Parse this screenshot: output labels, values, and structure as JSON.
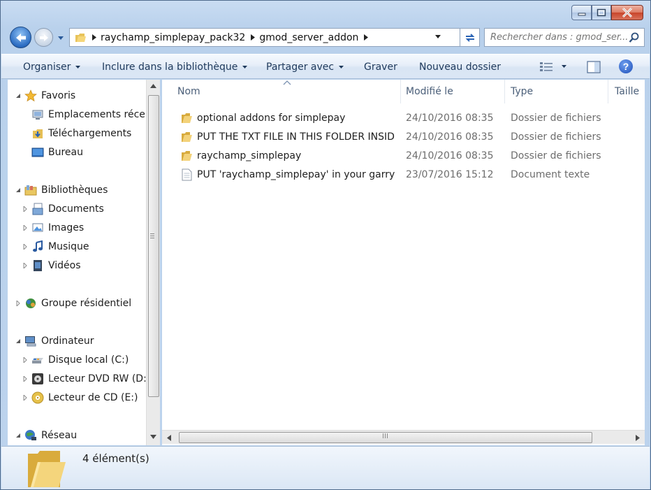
{
  "window": {
    "caption_buttons": {
      "minimize": "minimize",
      "maximize": "maximize",
      "close": "close"
    }
  },
  "navbar": {
    "breadcrumb": [
      "raychamp_simplepay_pack32",
      "gmod_server_addon"
    ],
    "search_placeholder": "Rechercher dans : gmod_ser..."
  },
  "toolbar": {
    "organize": "Organiser",
    "include_library": "Inclure dans la bibliothèque",
    "share_with": "Partager avec",
    "burn": "Graver",
    "new_folder": "Nouveau dossier"
  },
  "sidebar": {
    "favorites": {
      "label": "Favoris",
      "items": [
        {
          "label": "Emplacements récents",
          "icon": "recent-places-icon"
        },
        {
          "label": "Téléchargements",
          "icon": "downloads-icon"
        },
        {
          "label": "Bureau",
          "icon": "desktop-icon"
        }
      ]
    },
    "libraries": {
      "label": "Bibliothèques",
      "items": [
        {
          "label": "Documents",
          "icon": "documents-icon"
        },
        {
          "label": "Images",
          "icon": "pictures-icon"
        },
        {
          "label": "Musique",
          "icon": "music-icon"
        },
        {
          "label": "Vidéos",
          "icon": "videos-icon"
        }
      ]
    },
    "homegroup": {
      "label": "Groupe résidentiel"
    },
    "computer": {
      "label": "Ordinateur",
      "items": [
        {
          "label": "Disque local (C:)",
          "icon": "hard-drive-icon"
        },
        {
          "label": "Lecteur DVD RW (D:)",
          "icon": "dvd-drive-icon"
        },
        {
          "label": "Lecteur de CD (E:)",
          "icon": "cd-drive-icon"
        }
      ]
    },
    "network": {
      "label": "Réseau"
    }
  },
  "file_list": {
    "columns": [
      "Nom",
      "Modifié le",
      "Type",
      "Taille"
    ],
    "rows": [
      {
        "name": "optional addons for simplepay",
        "modified": "24/10/2016 08:35",
        "type": "Dossier de fichiers",
        "icon": "folder-icon"
      },
      {
        "name": "PUT THE TXT FILE IN THIS FOLDER INSID...",
        "modified": "24/10/2016 08:35",
        "type": "Dossier de fichiers",
        "icon": "folder-icon"
      },
      {
        "name": "raychamp_simplepay",
        "modified": "24/10/2016 08:35",
        "type": "Dossier de fichiers",
        "icon": "folder-icon"
      },
      {
        "name": "PUT 'raychamp_simplepay' in your garry's...",
        "modified": "23/07/2016 15:12",
        "type": "Document texte",
        "icon": "text-document-icon"
      }
    ]
  },
  "status": {
    "item_count": "4 élément(s)"
  },
  "colors": {
    "window_frame": "#c3d7ee",
    "command_text": "#1e395b",
    "secondary_text": "#6d6d6d"
  }
}
